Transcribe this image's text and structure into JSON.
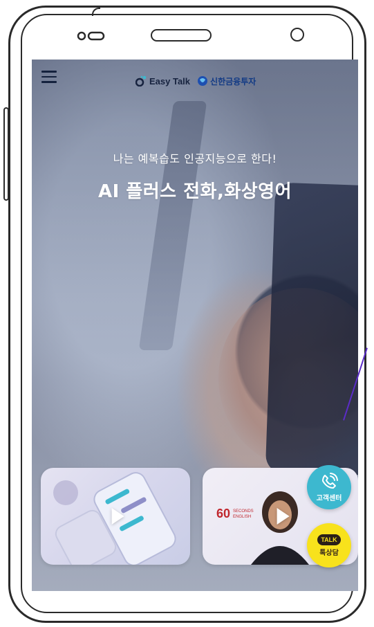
{
  "header": {
    "menu_icon": "hamburger-menu-icon",
    "easytalk_logo": "Easy Talk",
    "shinhan_logo": "신한금융투자"
  },
  "hero": {
    "subtitle": "나는 예복습도 인공지능으로 한다!",
    "title": "AI 플러스 전화,화상영어"
  },
  "cards": [
    {
      "name": "ai-chat-video-card",
      "icon": "play-icon"
    },
    {
      "name": "60-seconds-english-video-card",
      "badge": "60 SECONDS ENGLISH",
      "icon": "play-icon"
    }
  ],
  "floating": {
    "customer_center": "고객센터",
    "talk_badge": "TALK",
    "talk_label": "톡상담"
  },
  "colors": {
    "cyan": "#3db8cf",
    "kakao_yellow": "#f8e21c",
    "navy": "#14213d"
  }
}
